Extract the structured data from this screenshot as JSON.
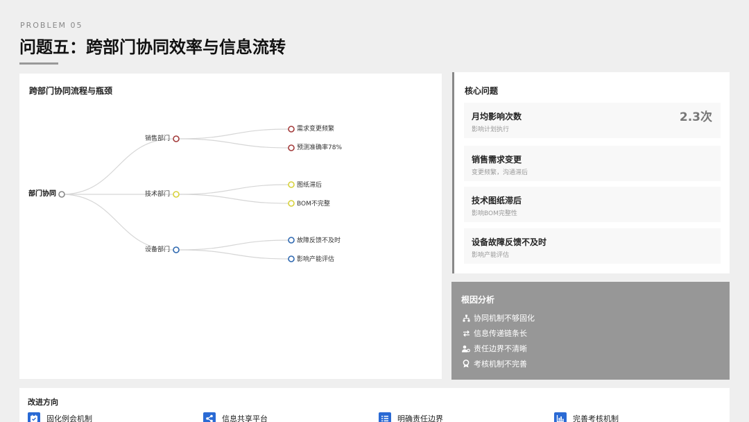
{
  "header": {
    "eyebrow": "PROBLEM 05",
    "title": "问题五：跨部门协同效率与信息流转"
  },
  "flow": {
    "title": "跨部门协同流程与瓶颈",
    "root": {
      "label": "部门协同",
      "color": "#888888"
    },
    "branches": [
      {
        "label": "销售部门",
        "color": "#a33a3a",
        "leaves": [
          "需求变更频繁",
          "预测准确率78%"
        ]
      },
      {
        "label": "技术部门",
        "color": "#d8d23a",
        "leaves": [
          "图纸滞后",
          "BOM不完整"
        ]
      },
      {
        "label": "设备部门",
        "color": "#2e68b0",
        "leaves": [
          "故障反馈不及时",
          "影响产能评估"
        ]
      }
    ]
  },
  "core": {
    "title": "核心问题",
    "items": [
      {
        "title": "月均影响次数",
        "sub": "影响计划执行",
        "value": "2.3次"
      },
      {
        "title": "销售需求变更",
        "sub": "变更频繁，沟通滞后",
        "value": ""
      },
      {
        "title": "技术图纸滞后",
        "sub": "影响BOM完整性",
        "value": ""
      },
      {
        "title": "设备故障反馈不及时",
        "sub": "影响产能评估",
        "value": ""
      }
    ]
  },
  "root_cause": {
    "title": "根因分析",
    "items": [
      {
        "icon": "sitemap-icon",
        "label": "协同机制不够固化"
      },
      {
        "icon": "exchange-icon",
        "label": "信息传递链条长"
      },
      {
        "icon": "user-cog-icon",
        "label": "责任边界不清晰"
      },
      {
        "icon": "award-icon",
        "label": "考核机制不完善"
      }
    ]
  },
  "improve": {
    "title": "改进方向",
    "accent": "#2a6ad4",
    "items": [
      {
        "icon": "calendar-check-icon",
        "label": "固化例会机制"
      },
      {
        "icon": "share-icon",
        "label": "信息共享平台"
      },
      {
        "icon": "list-ordered-icon",
        "label": "明确责任边界"
      },
      {
        "icon": "chart-bar-icon",
        "label": "完善考核机制"
      }
    ]
  }
}
